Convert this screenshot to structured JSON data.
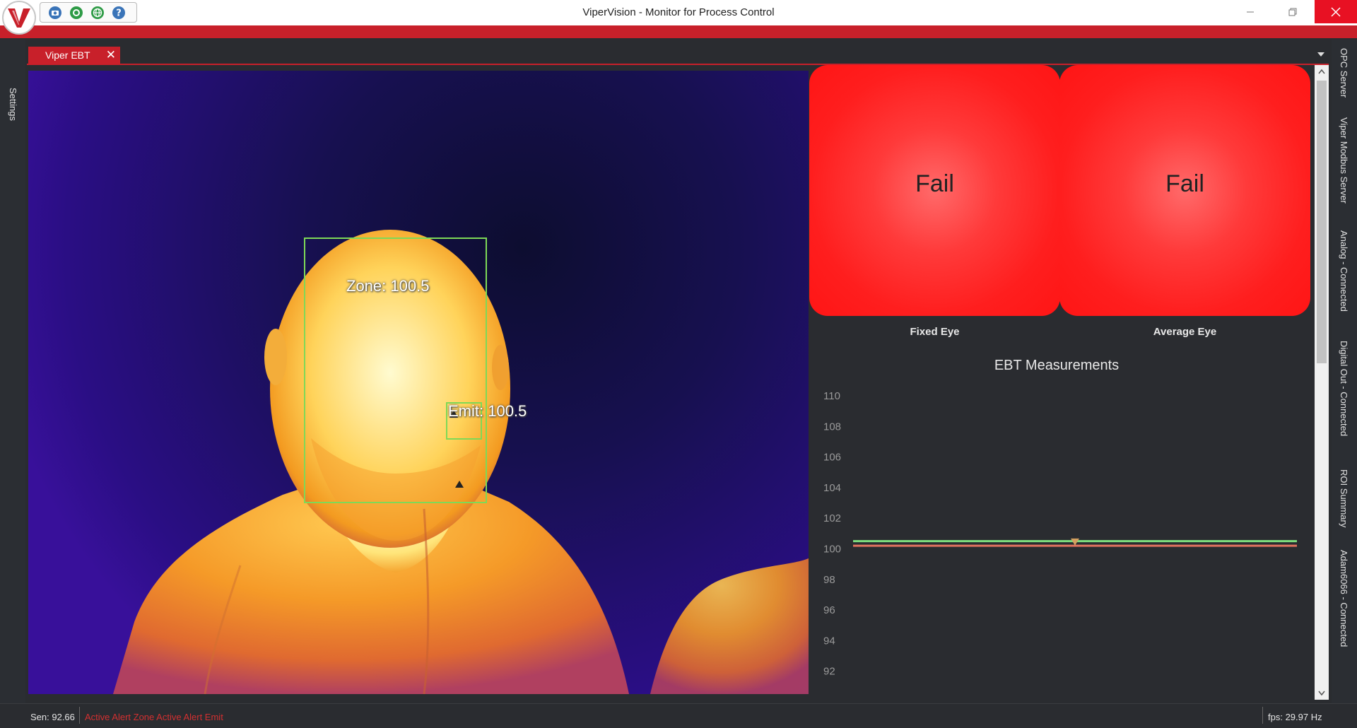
{
  "window": {
    "title": "ViperVision - Monitor for Process Control",
    "logo_letter": "V"
  },
  "toolbar": {
    "icons": [
      "camera-icon",
      "record-icon",
      "globe-icon",
      "help-icon"
    ]
  },
  "left_dock": {
    "tabs": [
      "Settings"
    ]
  },
  "document_tab": {
    "label": "Viper EBT",
    "close": "✕"
  },
  "thermal_image": {
    "zone_label": "Zone: 100.5",
    "emit_label": "Emit: 100.5"
  },
  "status_panels": {
    "fixed_eye": {
      "status": "Fail",
      "caption": "Fixed Eye"
    },
    "average_eye": {
      "status": "Fail",
      "caption": "Average Eye"
    }
  },
  "chart_data": {
    "type": "line",
    "title": "EBT Measurements",
    "yticks": [
      "110",
      "108",
      "106",
      "104",
      "102",
      "100",
      "98",
      "96",
      "94",
      "92"
    ],
    "ylim": [
      90,
      111
    ],
    "series": [
      {
        "color": "#7fe07f",
        "values": [
          100.5,
          100.5
        ]
      },
      {
        "color": "#e2735f",
        "values": [
          100.2,
          100.2
        ]
      }
    ],
    "marker_value": 100.4,
    "grid": false
  },
  "right_dock": {
    "tabs": [
      "OPC Server",
      "Viper Modbus Server",
      "Analog - Connected",
      "Digital Out - Connected",
      "ROI Summary",
      "Adam6066 - Connected"
    ]
  },
  "status_bar": {
    "sen": "Sen: 92.66",
    "alerts": "Active Alert Zone Active Alert Emit",
    "fps": "fps: 29.97 Hz"
  },
  "colors": {
    "accent_red": "#c8202a",
    "fail_red": "#ff1e1e",
    "roi_green": "#7ed957"
  }
}
